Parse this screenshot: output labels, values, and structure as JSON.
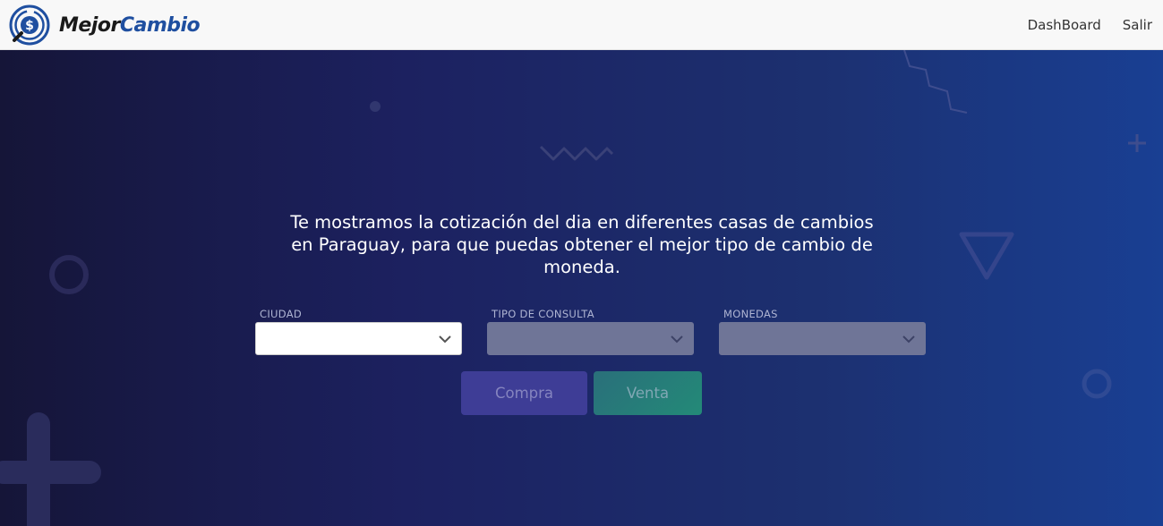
{
  "brand": {
    "name_part1": "Mejor",
    "name_part2": "Cambio"
  },
  "nav": {
    "items": [
      {
        "label": "DashBoard"
      },
      {
        "label": "Salir"
      }
    ]
  },
  "hero": {
    "headline_line1": "Te mostramos la cotización del dia en diferentes casas de cambios",
    "headline_line2": "en Paraguay, para que puedas obtener el mejor tipo de cambio de",
    "headline_line3": "moneda."
  },
  "filters": {
    "ciudad": {
      "label": "CIUDAD",
      "value": "",
      "enabled": true
    },
    "tipo_consulta": {
      "label": "TIPO DE CONSULTA",
      "value": "",
      "enabled": false
    },
    "monedas": {
      "label": "MONEDAS",
      "value": "",
      "enabled": false
    }
  },
  "actions": {
    "compra_label": "Compra",
    "venta_label": "Venta"
  },
  "colors": {
    "brand_blue": "#1f4fa0",
    "hero_dark": "#151538",
    "hero_light": "#193f93",
    "compra_bg": "#3e3d96",
    "venta_bg": "#238a78"
  },
  "icons": {
    "logo": "dollar-circle-logo",
    "select_indicator": "chevron-down-icon"
  }
}
